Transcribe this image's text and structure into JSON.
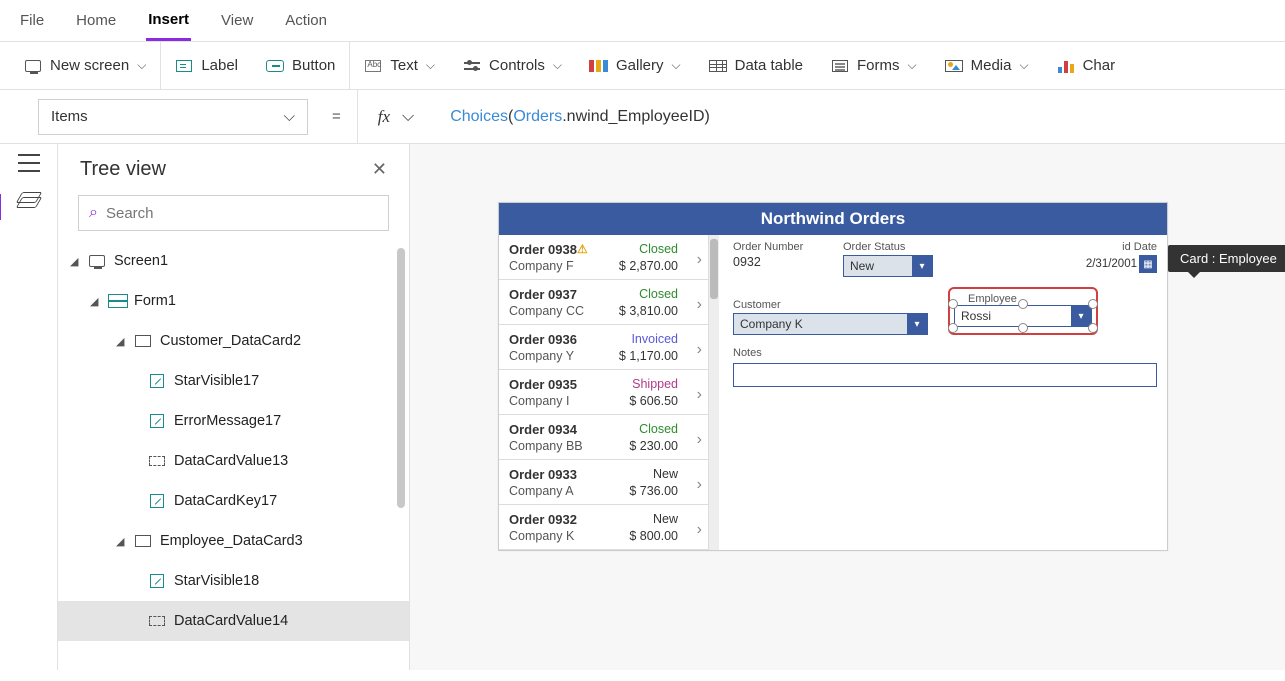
{
  "menu": {
    "file": "File",
    "home": "Home",
    "insert": "Insert",
    "view": "View",
    "action": "Action"
  },
  "ribbon": {
    "new_screen": "New screen",
    "label": "Label",
    "button": "Button",
    "text": "Text",
    "controls": "Controls",
    "gallery": "Gallery",
    "data_table": "Data table",
    "forms": "Forms",
    "media": "Media",
    "chart": "Char"
  },
  "fbar": {
    "property": "Items",
    "formula_fn": "Choices",
    "formula_obj": "Orders",
    "formula_rest": ".nwind_EmployeeID)"
  },
  "tree": {
    "title": "Tree view",
    "search_placeholder": "Search",
    "nodes": {
      "screen1": "Screen1",
      "form1": "Form1",
      "customer_card": "Customer_DataCard2",
      "starvisible17": "StarVisible17",
      "errormessage17": "ErrorMessage17",
      "datacardvalue13": "DataCardValue13",
      "datacardkey17": "DataCardKey17",
      "employee_card": "Employee_DataCard3",
      "starvisible18": "StarVisible18",
      "datacardvalue14": "DataCardValue14"
    }
  },
  "app": {
    "title": "Northwind Orders",
    "orders": [
      {
        "num": "Order 0938",
        "warn": true,
        "company": "Company F",
        "status": "Closed",
        "status_cls": "st-closed",
        "price": "$ 2,870.00"
      },
      {
        "num": "Order 0937",
        "warn": false,
        "company": "Company CC",
        "status": "Closed",
        "status_cls": "st-closed",
        "price": "$ 3,810.00"
      },
      {
        "num": "Order 0936",
        "warn": false,
        "company": "Company Y",
        "status": "Invoiced",
        "status_cls": "st-invoiced",
        "price": "$ 1,170.00"
      },
      {
        "num": "Order 0935",
        "warn": false,
        "company": "Company I",
        "status": "Shipped",
        "status_cls": "st-shipped",
        "price": "$ 606.50"
      },
      {
        "num": "Order 0934",
        "warn": false,
        "company": "Company BB",
        "status": "Closed",
        "status_cls": "st-closed",
        "price": "$ 230.00"
      },
      {
        "num": "Order 0933",
        "warn": false,
        "company": "Company A",
        "status": "New",
        "status_cls": "st-new",
        "price": "$ 736.00"
      },
      {
        "num": "Order 0932",
        "warn": false,
        "company": "Company K",
        "status": "New",
        "status_cls": "st-new",
        "price": "$ 800.00"
      }
    ],
    "form": {
      "order_number_label": "Order Number",
      "order_number_value": "0932",
      "order_status_label": "Order Status",
      "order_status_value": "New",
      "paid_date_label": "id Date",
      "paid_date_value": "2/31/2001",
      "customer_label": "Customer",
      "customer_value": "Company K",
      "employee_label": "Employee",
      "employee_value": "Rossi",
      "notes_label": "Notes"
    },
    "tooltip": "Card : Employee"
  }
}
